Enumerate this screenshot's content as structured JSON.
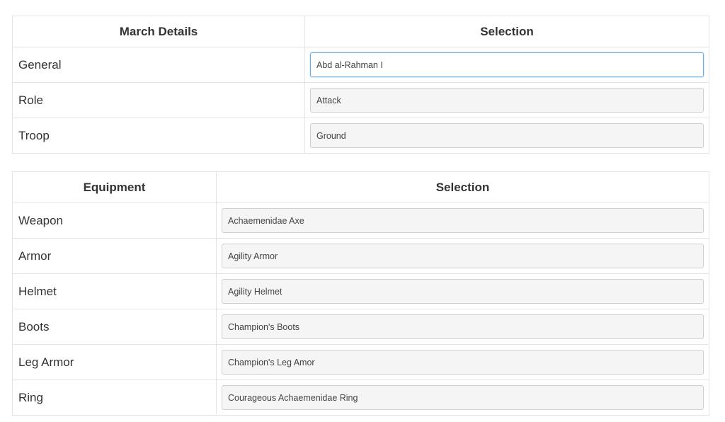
{
  "march": {
    "header_label": "March Details",
    "header_selection": "Selection",
    "rows": [
      {
        "label": "General",
        "value": "Abd al-Rahman I"
      },
      {
        "label": "Role",
        "value": "Attack"
      },
      {
        "label": "Troop",
        "value": "Ground"
      }
    ]
  },
  "equipment": {
    "header_label": "Equipment",
    "header_selection": "Selection",
    "rows": [
      {
        "label": "Weapon",
        "value": "Achaemenidae Axe"
      },
      {
        "label": "Armor",
        "value": "Agility Armor"
      },
      {
        "label": "Helmet",
        "value": "Agility Helmet"
      },
      {
        "label": "Boots",
        "value": "Champion's Boots"
      },
      {
        "label": "Leg Armor",
        "value": "Champion's Leg Amor"
      },
      {
        "label": "Ring",
        "value": "Courageous Achaemenidae Ring"
      }
    ]
  },
  "colors": {
    "border": "#e3e3e3",
    "focus_border": "#66afe9",
    "select_bg": "#f5f5f5"
  }
}
